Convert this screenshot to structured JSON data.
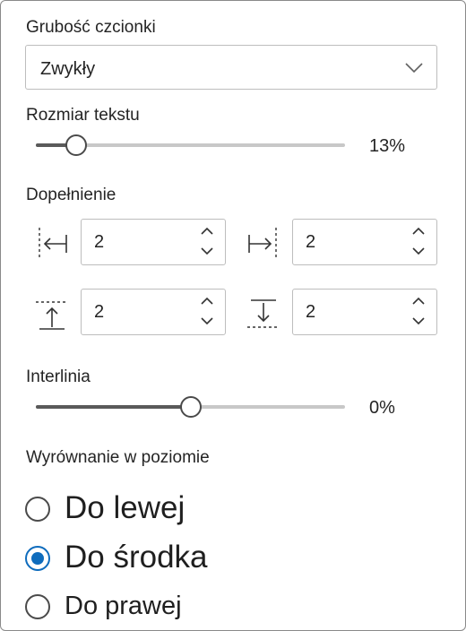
{
  "font_weight": {
    "label": "Grubość czcionki",
    "value": "Zwykły"
  },
  "text_size": {
    "label": "Rozmiar tekstu",
    "value_text": "13%",
    "level": 0.13
  },
  "padding": {
    "label": "Dopełnienie",
    "left": "2",
    "right": "2",
    "top": "2",
    "bottom": "2"
  },
  "line_spacing": {
    "label": "Interlinia",
    "value_text": "0%",
    "level": 0.5
  },
  "horizontal_align": {
    "label": "Wyrównanie w poziomie",
    "options": [
      {
        "label": "Do lewej",
        "checked": false
      },
      {
        "label": "Do środka",
        "checked": true
      },
      {
        "label": "Do prawej",
        "checked": false
      }
    ]
  },
  "colors": {
    "accent": "#0f6cbd",
    "slider_fill": "#5a5a5a",
    "slider_track": "#c8c8c8"
  }
}
